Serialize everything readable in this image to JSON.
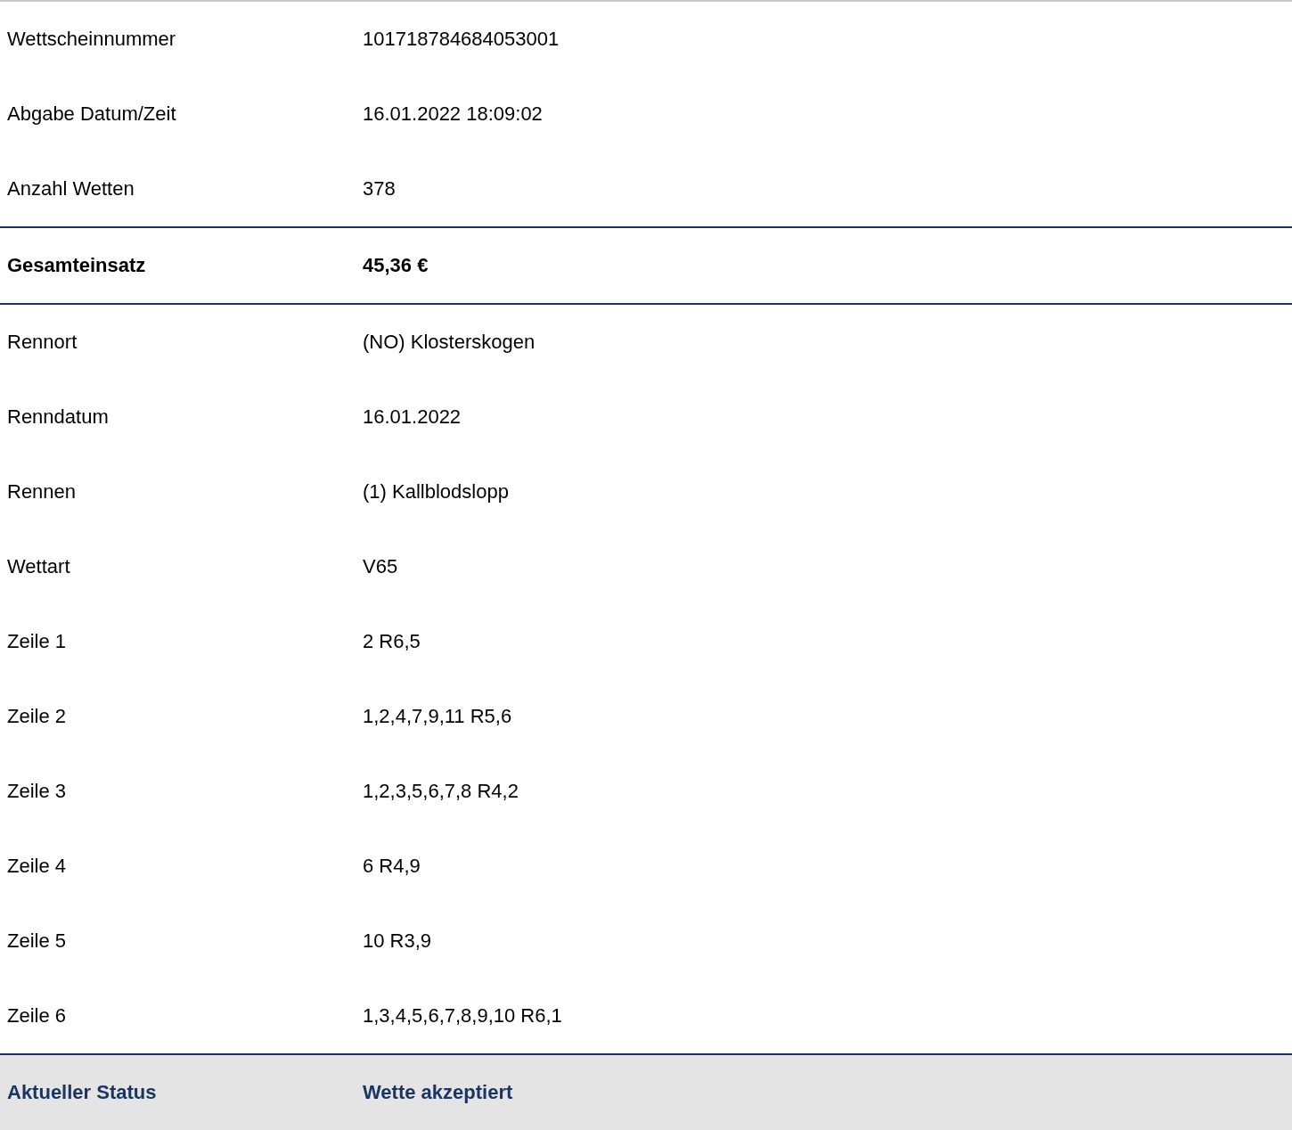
{
  "rows": [
    {
      "kind": "normal",
      "label": "Wettscheinnummer",
      "value": "101718784684053001"
    },
    {
      "kind": "normal",
      "label": "Abgabe Datum/Zeit",
      "value": "16.01.2022 18:09:02"
    },
    {
      "kind": "normal",
      "label": "Anzahl Wetten",
      "value": "378"
    },
    {
      "kind": "total",
      "label": "Gesamteinsatz",
      "value": "45,36 €"
    },
    {
      "kind": "normal",
      "label": "Rennort",
      "value": "(NO) Klosterskogen"
    },
    {
      "kind": "normal",
      "label": "Renndatum",
      "value": "16.01.2022"
    },
    {
      "kind": "normal",
      "label": "Rennen",
      "value": "(1) Kallblodslopp"
    },
    {
      "kind": "normal",
      "label": "Wettart",
      "value": "V65"
    },
    {
      "kind": "normal",
      "label": "Zeile 1",
      "value": "2 R6,5"
    },
    {
      "kind": "normal",
      "label": "Zeile 2",
      "value": "1,2,4,7,9,11 R5,6"
    },
    {
      "kind": "normal",
      "label": "Zeile 3",
      "value": "1,2,3,5,6,7,8 R4,2"
    },
    {
      "kind": "normal",
      "label": "Zeile 4",
      "value": "6 R4,9"
    },
    {
      "kind": "normal",
      "label": "Zeile 5",
      "value": "10 R3,9"
    },
    {
      "kind": "normal",
      "label": "Zeile 6",
      "value": "1,3,4,5,6,7,8,9,10 R6,1"
    },
    {
      "kind": "status",
      "label": "Aktueller Status",
      "value": "Wette akzeptiert"
    }
  ]
}
